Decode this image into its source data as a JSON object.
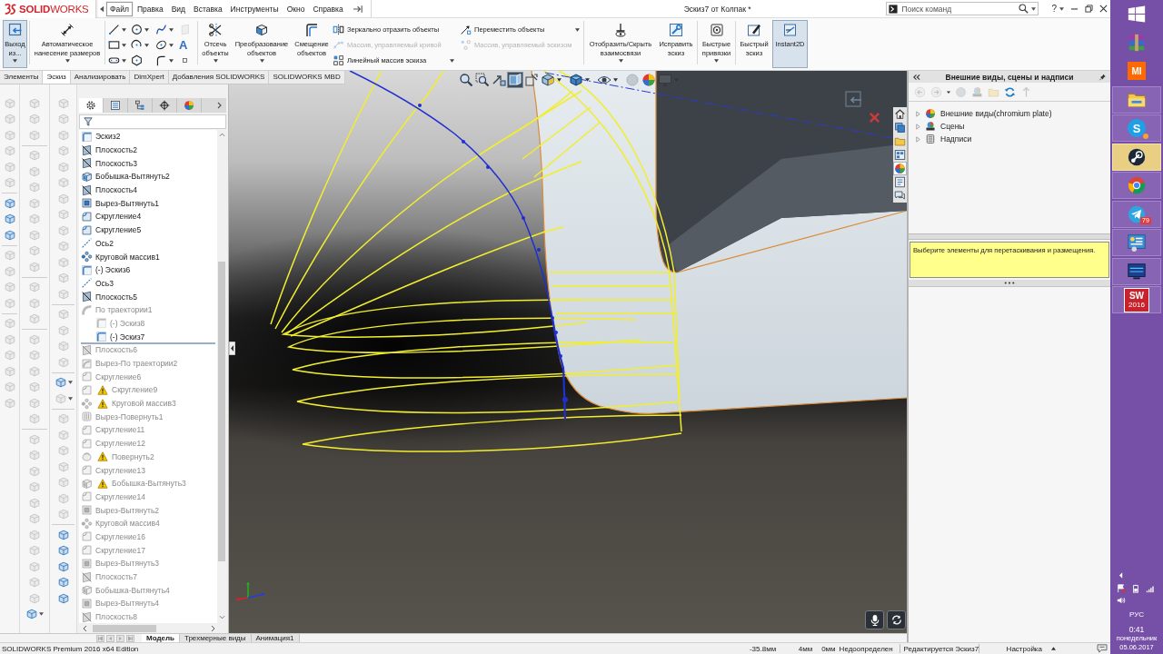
{
  "app": {
    "logo": "**SOLID**WORKS",
    "title": "Эскиз7 от Колпак *"
  },
  "menu": [
    {
      "label": "Файл",
      "selected": true
    },
    {
      "label": "Правка",
      "selected": false
    },
    {
      "label": "Вид",
      "selected": false
    },
    {
      "label": "Вставка",
      "selected": false
    },
    {
      "label": "Инструменты",
      "selected": false
    },
    {
      "label": "Окно",
      "selected": false
    },
    {
      "label": "Справка",
      "selected": false
    }
  ],
  "search": {
    "placeholder": "Поиск команд"
  },
  "help": {
    "label": "?"
  },
  "ribbon": [
    [
      {
        "kind": "large",
        "label": "Выход из...",
        "dropdown": true,
        "selected": true
      }
    ],
    [
      {
        "kind": "large",
        "label": "Автоматическое нанесение размеров",
        "dropdown": true,
        "selected": false
      }
    ],
    [
      {
        "kind": "tools",
        "tools": [
          {
            "dropdown": true,
            "disabled": false
          },
          {
            "dropdown": true,
            "disabled": false
          },
          {
            "dropdown": true,
            "disabled": false
          },
          {
            "dropdown": false,
            "disabled": true
          },
          {
            "dropdown": true,
            "disabled": false
          },
          {
            "dropdown": true,
            "disabled": false
          },
          {
            "dropdown": true,
            "disabled": false
          },
          {
            "label": "A",
            "dropdown": false,
            "disabled": false
          },
          {
            "dropdown": true,
            "disabled": false
          },
          {
            "dropdown": false,
            "disabled": false
          },
          {
            "dropdown": true,
            "disabled": false
          },
          {
            "dropdown": false,
            "disabled": false
          }
        ]
      }
    ],
    [
      {
        "kind": "large",
        "label": "Отсечь объекты",
        "dropdown": true,
        "selected": false
      },
      {
        "kind": "large",
        "label": "Преобразование объектов",
        "dropdown": true,
        "selected": false
      },
      {
        "kind": "large",
        "label": "Смещение объектов",
        "dropdown": false,
        "selected": false
      },
      {
        "kind": "stack",
        "rows": [
          {
            "label": "Зеркально отразить объекты",
            "disabled": false,
            "dropdown": false
          },
          {
            "label": "Массив, управляемый кривой",
            "disabled": true,
            "dropdown": false
          },
          {
            "label": "Линейный массив эскиза",
            "disabled": false,
            "dropdown": true
          }
        ]
      },
      {
        "kind": "stack",
        "rows": [
          {
            "label": "Переместить объекты",
            "disabled": false,
            "dropdown": true
          },
          {
            "label": "Массив, управляемый эскизом",
            "disabled": true,
            "dropdown": false
          }
        ]
      }
    ],
    [
      {
        "kind": "large",
        "label": "Отобразить/Скрыть взаимосвязи",
        "dropdown": true,
        "selected": false
      },
      {
        "kind": "large",
        "label": "Исправить эскиз",
        "dropdown": false,
        "selected": false
      }
    ],
    [
      {
        "kind": "large",
        "label": "Быстрые привязки",
        "dropdown": true,
        "selected": false
      }
    ],
    [
      {
        "kind": "large",
        "label": "Быстрый эскиз",
        "dropdown": false,
        "selected": false
      },
      {
        "kind": "large",
        "label": "Instant2D",
        "dropdown": false,
        "selected": true
      }
    ]
  ],
  "command_tabs": [
    {
      "label": "Элементы",
      "selected": false
    },
    {
      "label": "Эскиз",
      "selected": true
    },
    {
      "label": "Анализировать",
      "selected": false
    },
    {
      "label": "DimXpert",
      "selected": false
    },
    {
      "label": "Добавления SOLIDWORKS",
      "selected": false
    },
    {
      "label": "SOLIDWORKS MBD",
      "selected": false
    }
  ],
  "left_toolbars": [
    [
      [
        {
          "disabled": true,
          "dropdown": false
        },
        {
          "disabled": true,
          "dropdown": false
        },
        {
          "disabled": true,
          "dropdown": false
        },
        {
          "disabled": true,
          "dropdown": false
        },
        {
          "disabled": true,
          "dropdown": false
        },
        {
          "disabled": true,
          "dropdown": false
        }
      ],
      [
        {
          "disabled": false,
          "dropdown": false
        },
        {
          "disabled": false,
          "dropdown": false
        },
        {
          "disabled": false,
          "dropdown": false
        }
      ],
      [
        {
          "disabled": true,
          "dropdown": false
        },
        {
          "disabled": true,
          "dropdown": false
        },
        {
          "disabled": true,
          "dropdown": false
        },
        {
          "disabled": true,
          "dropdown": false
        }
      ],
      [
        {
          "disabled": true,
          "dropdown": false
        },
        {
          "disabled": true,
          "dropdown": false
        },
        {
          "disabled": true,
          "dropdown": false
        },
        {
          "disabled": true,
          "dropdown": false
        },
        {
          "disabled": true,
          "dropdown": false
        },
        {
          "disabled": true,
          "dropdown": false
        }
      ]
    ],
    [
      [
        {
          "disabled": true,
          "dropdown": false
        },
        {
          "disabled": true,
          "dropdown": false
        },
        {
          "disabled": true,
          "dropdown": false
        }
      ],
      [
        {
          "disabled": true,
          "dropdown": false
        },
        {
          "disabled": true,
          "dropdown": false
        },
        {
          "disabled": true,
          "dropdown": false
        },
        {
          "disabled": true,
          "dropdown": false
        },
        {
          "disabled": true,
          "dropdown": false
        },
        {
          "disabled": true,
          "dropdown": false
        },
        {
          "disabled": true,
          "dropdown": false
        },
        {
          "disabled": true,
          "dropdown": false
        }
      ],
      [
        {
          "disabled": true,
          "dropdown": false
        },
        {
          "disabled": true,
          "dropdown": false
        },
        {
          "disabled": true,
          "dropdown": false
        }
      ],
      [
        {
          "disabled": true,
          "dropdown": false
        },
        {
          "disabled": true,
          "dropdown": false
        },
        {
          "disabled": true,
          "dropdown": false
        },
        {
          "disabled": true,
          "dropdown": false
        },
        {
          "disabled": true,
          "dropdown": false
        },
        {
          "disabled": true,
          "dropdown": false
        }
      ],
      [
        {
          "disabled": true,
          "dropdown": false
        },
        {
          "disabled": true,
          "dropdown": false
        },
        {
          "disabled": true,
          "dropdown": false
        },
        {
          "disabled": true,
          "dropdown": false
        },
        {
          "disabled": true,
          "dropdown": false
        },
        {
          "disabled": true,
          "dropdown": false
        },
        {
          "disabled": true,
          "dropdown": false
        },
        {
          "disabled": true,
          "dropdown": false
        },
        {
          "disabled": true,
          "dropdown": false
        },
        {
          "disabled": true,
          "dropdown": false
        },
        {
          "disabled": true,
          "dropdown": false
        },
        {
          "disabled": false,
          "dropdown": true
        }
      ]
    ],
    [
      [
        {
          "disabled": true,
          "dropdown": false
        },
        {
          "disabled": true,
          "dropdown": false
        },
        {
          "disabled": true,
          "dropdown": false
        },
        {
          "disabled": true,
          "dropdown": false
        },
        {
          "disabled": true,
          "dropdown": false
        },
        {
          "disabled": true,
          "dropdown": false
        },
        {
          "disabled": true,
          "dropdown": false
        },
        {
          "disabled": true,
          "dropdown": false
        },
        {
          "disabled": true,
          "dropdown": false
        },
        {
          "disabled": true,
          "dropdown": false
        },
        {
          "disabled": true,
          "dropdown": false
        },
        {
          "disabled": true,
          "dropdown": false
        },
        {
          "disabled": true,
          "dropdown": false
        }
      ],
      [
        {
          "disabled": true,
          "dropdown": false
        },
        {
          "disabled": true,
          "dropdown": false
        },
        {
          "disabled": true,
          "dropdown": false
        },
        {
          "disabled": true,
          "dropdown": false
        }
      ],
      [
        {
          "disabled": false,
          "dropdown": true
        },
        {
          "disabled": true,
          "dropdown": true
        }
      ],
      [
        {
          "disabled": true,
          "dropdown": false
        },
        {
          "disabled": true,
          "dropdown": false
        },
        {
          "disabled": true,
          "dropdown": false
        },
        {
          "disabled": true,
          "dropdown": false
        },
        {
          "disabled": true,
          "dropdown": false
        },
        {
          "disabled": true,
          "dropdown": false
        },
        {
          "disabled": true,
          "dropdown": false
        }
      ],
      [
        {
          "disabled": false,
          "dropdown": false
        },
        {
          "disabled": false,
          "dropdown": false
        },
        {
          "disabled": false,
          "dropdown": false
        },
        {
          "disabled": false,
          "dropdown": false
        },
        {
          "disabled": false,
          "dropdown": false
        }
      ]
    ]
  ],
  "feature_tree": {
    "tabs": [
      {
        "selected": true
      },
      {
        "selected": false
      },
      {
        "selected": false
      },
      {
        "selected": false
      },
      {
        "selected": false
      }
    ],
    "items": [
      {
        "label": "Эскиз2",
        "kind": "sketch",
        "dimmed": false,
        "warning": false
      },
      {
        "label": "Плоскость2",
        "kind": "plane",
        "dimmed": false,
        "warning": false
      },
      {
        "label": "Плоскость3",
        "kind": "plane",
        "dimmed": false,
        "warning": false
      },
      {
        "label": "Бобышка-Вытянуть2",
        "kind": "boss",
        "dimmed": false,
        "warning": false
      },
      {
        "label": "Плоскость4",
        "kind": "plane",
        "dimmed": false,
        "warning": false
      },
      {
        "label": "Вырез-Вытянуть1",
        "kind": "cut",
        "dimmed": false,
        "warning": false
      },
      {
        "label": "Скругление4",
        "kind": "fillet",
        "dimmed": false,
        "warning": false
      },
      {
        "label": "Скругление5",
        "kind": "fillet",
        "dimmed": false,
        "warning": false
      },
      {
        "label": "Ось2",
        "kind": "axis",
        "dimmed": false,
        "warning": false
      },
      {
        "label": "Круговой массив1",
        "kind": "pattern",
        "dimmed": false,
        "warning": false
      },
      {
        "label": "(-) Эскиз6",
        "kind": "sketch",
        "dimmed": false,
        "warning": false
      },
      {
        "label": "Ось3",
        "kind": "axis",
        "dimmed": false,
        "warning": false
      },
      {
        "label": "Плоскость5",
        "kind": "plane",
        "dimmed": false,
        "warning": false
      },
      {
        "label": "По траектории1",
        "kind": "sweep",
        "dimmed": true,
        "warning": false,
        "children": [
          {
            "label": "(-) Эскиз8",
            "kind": "sketch",
            "dimmed": true,
            "warning": false
          },
          {
            "label": "(-) Эскиз7",
            "kind": "sketch",
            "dimmed": false,
            "warning": false
          }
        ]
      },
      {
        "kind": "rollback-bar"
      },
      {
        "label": "Плоскость6",
        "kind": "plane",
        "dimmed": true,
        "warning": false
      },
      {
        "label": "Вырез-По траектории2",
        "kind": "cutsweep",
        "dimmed": true,
        "warning": false
      },
      {
        "label": "Скругление6",
        "kind": "fillet",
        "dimmed": true,
        "warning": false
      },
      {
        "label": "Скругление9",
        "kind": "fillet",
        "dimmed": true,
        "warning": true
      },
      {
        "label": "Круговой массив3",
        "kind": "pattern",
        "dimmed": true,
        "warning": true
      },
      {
        "label": "Вырез-Повернуть1",
        "kind": "cutrevolve",
        "dimmed": true,
        "warning": false
      },
      {
        "label": "Скругление11",
        "kind": "fillet",
        "dimmed": true,
        "warning": false
      },
      {
        "label": "Скругление12",
        "kind": "fillet",
        "dimmed": true,
        "warning": false
      },
      {
        "label": "Повернуть2",
        "kind": "revolve",
        "dimmed": true,
        "warning": true
      },
      {
        "label": "Скругление13",
        "kind": "fillet",
        "dimmed": true,
        "warning": false
      },
      {
        "label": "Бобышка-Вытянуть3",
        "kind": "boss",
        "dimmed": true,
        "warning": true
      },
      {
        "label": "Скругление14",
        "kind": "fillet",
        "dimmed": true,
        "warning": false
      },
      {
        "label": "Вырез-Вытянуть2",
        "kind": "cut",
        "dimmed": true,
        "warning": false
      },
      {
        "label": "Круговой массив4",
        "kind": "pattern",
        "dimmed": true,
        "warning": false
      },
      {
        "label": "Скругление16",
        "kind": "fillet",
        "dimmed": true,
        "warning": false
      },
      {
        "label": "Скругление17",
        "kind": "fillet",
        "dimmed": true,
        "warning": false
      },
      {
        "label": "Вырез-Вытянуть3",
        "kind": "cut",
        "dimmed": true,
        "warning": false
      },
      {
        "label": "Плоскость7",
        "kind": "plane",
        "dimmed": true,
        "warning": false
      },
      {
        "label": "Бобышка-Вытянуть4",
        "kind": "boss",
        "dimmed": true,
        "warning": false
      },
      {
        "label": "Вырез-Вытянуть4",
        "kind": "cut",
        "dimmed": true,
        "warning": false
      },
      {
        "label": "Плоскость8",
        "kind": "plane",
        "dimmed": true,
        "warning": false
      }
    ]
  },
  "view_toolbar": [
    {
      "selected": false,
      "disabled": false,
      "dropdown": false
    },
    {
      "selected": false,
      "disabled": false,
      "dropdown": false
    },
    {
      "selected": false,
      "disabled": false,
      "dropdown": false
    },
    {
      "selected": true,
      "disabled": false,
      "dropdown": false
    },
    {
      "selected": false,
      "disabled": false,
      "dropdown": false
    },
    {
      "selected": false,
      "disabled": false,
      "dropdown": true
    },
    {
      "selected": false,
      "disabled": false,
      "dropdown": true
    },
    {
      "selected": false,
      "disabled": false,
      "dropdown": true
    },
    {
      "selected": false,
      "disabled": true,
      "dropdown": false
    },
    {
      "selected": false,
      "disabled": false,
      "dropdown": false
    },
    {
      "selected": false,
      "disabled": true,
      "dropdown": true
    }
  ],
  "task_tabs": [
    {
      "selected": false
    },
    {
      "selected": false
    },
    {
      "selected": false
    },
    {
      "selected": false
    },
    {
      "selected": true
    },
    {
      "selected": false
    },
    {
      "selected": false
    }
  ],
  "bottom_tabs": [
    {
      "label": "Модель",
      "selected": true
    },
    {
      "label": "Трехмерные виды",
      "selected": false
    },
    {
      "label": "Анимация1",
      "selected": false
    }
  ],
  "task_pane": {
    "title": "Внешние виды, сцены и надписи",
    "toolbar": [
      {
        "disabled": true
      },
      {
        "disabled": true
      },
      {
        "disabled": false
      },
      {
        "disabled": true
      },
      {
        "disabled": true
      },
      {
        "disabled": true
      },
      {
        "disabled": false
      },
      {
        "disabled": true
      }
    ],
    "items": [
      {
        "label": "Внешние виды(chromium plate)",
        "expanded": false
      },
      {
        "label": "Сцены",
        "expanded": false
      },
      {
        "label": "Надписи",
        "expanded": false
      }
    ],
    "message": "Выберите элементы для перетаскивания и размещения."
  },
  "status_bar": {
    "edition": "SOLIDWORKS Premium 2016 x64 Edition",
    "readouts": [
      "-35.8мм",
      "4мм",
      "0мм"
    ],
    "sketch_state": "Недоопределен",
    "editing": "Редактируется Эскиз7",
    "units": "Настройка"
  },
  "taskbar": {
    "apps": [
      {
        "kind": "start",
        "running": false,
        "selected": false
      },
      {
        "kind": "archive",
        "running": false,
        "selected": false
      },
      {
        "kind": "mi",
        "label": "MI",
        "running": false,
        "selected": false
      },
      {
        "kind": "folder",
        "running": true,
        "selected": false
      },
      {
        "kind": "skype",
        "label": "S",
        "running": true,
        "selected": false
      },
      {
        "kind": "steam",
        "running": true,
        "selected": true
      },
      {
        "kind": "browser",
        "running": true,
        "selected": false
      },
      {
        "kind": "messenger",
        "badge": "79",
        "running": true,
        "selected": false
      },
      {
        "kind": "panel",
        "running": true,
        "selected": false
      },
      {
        "kind": "display",
        "running": true,
        "selected": false
      },
      {
        "kind": "cad",
        "label": "SW",
        "caption": "2016",
        "running": true,
        "selected": false
      }
    ],
    "tray": {
      "language": "РУС",
      "time": "0:41",
      "weekday": "понедельник",
      "date": "05.06.2017"
    }
  }
}
